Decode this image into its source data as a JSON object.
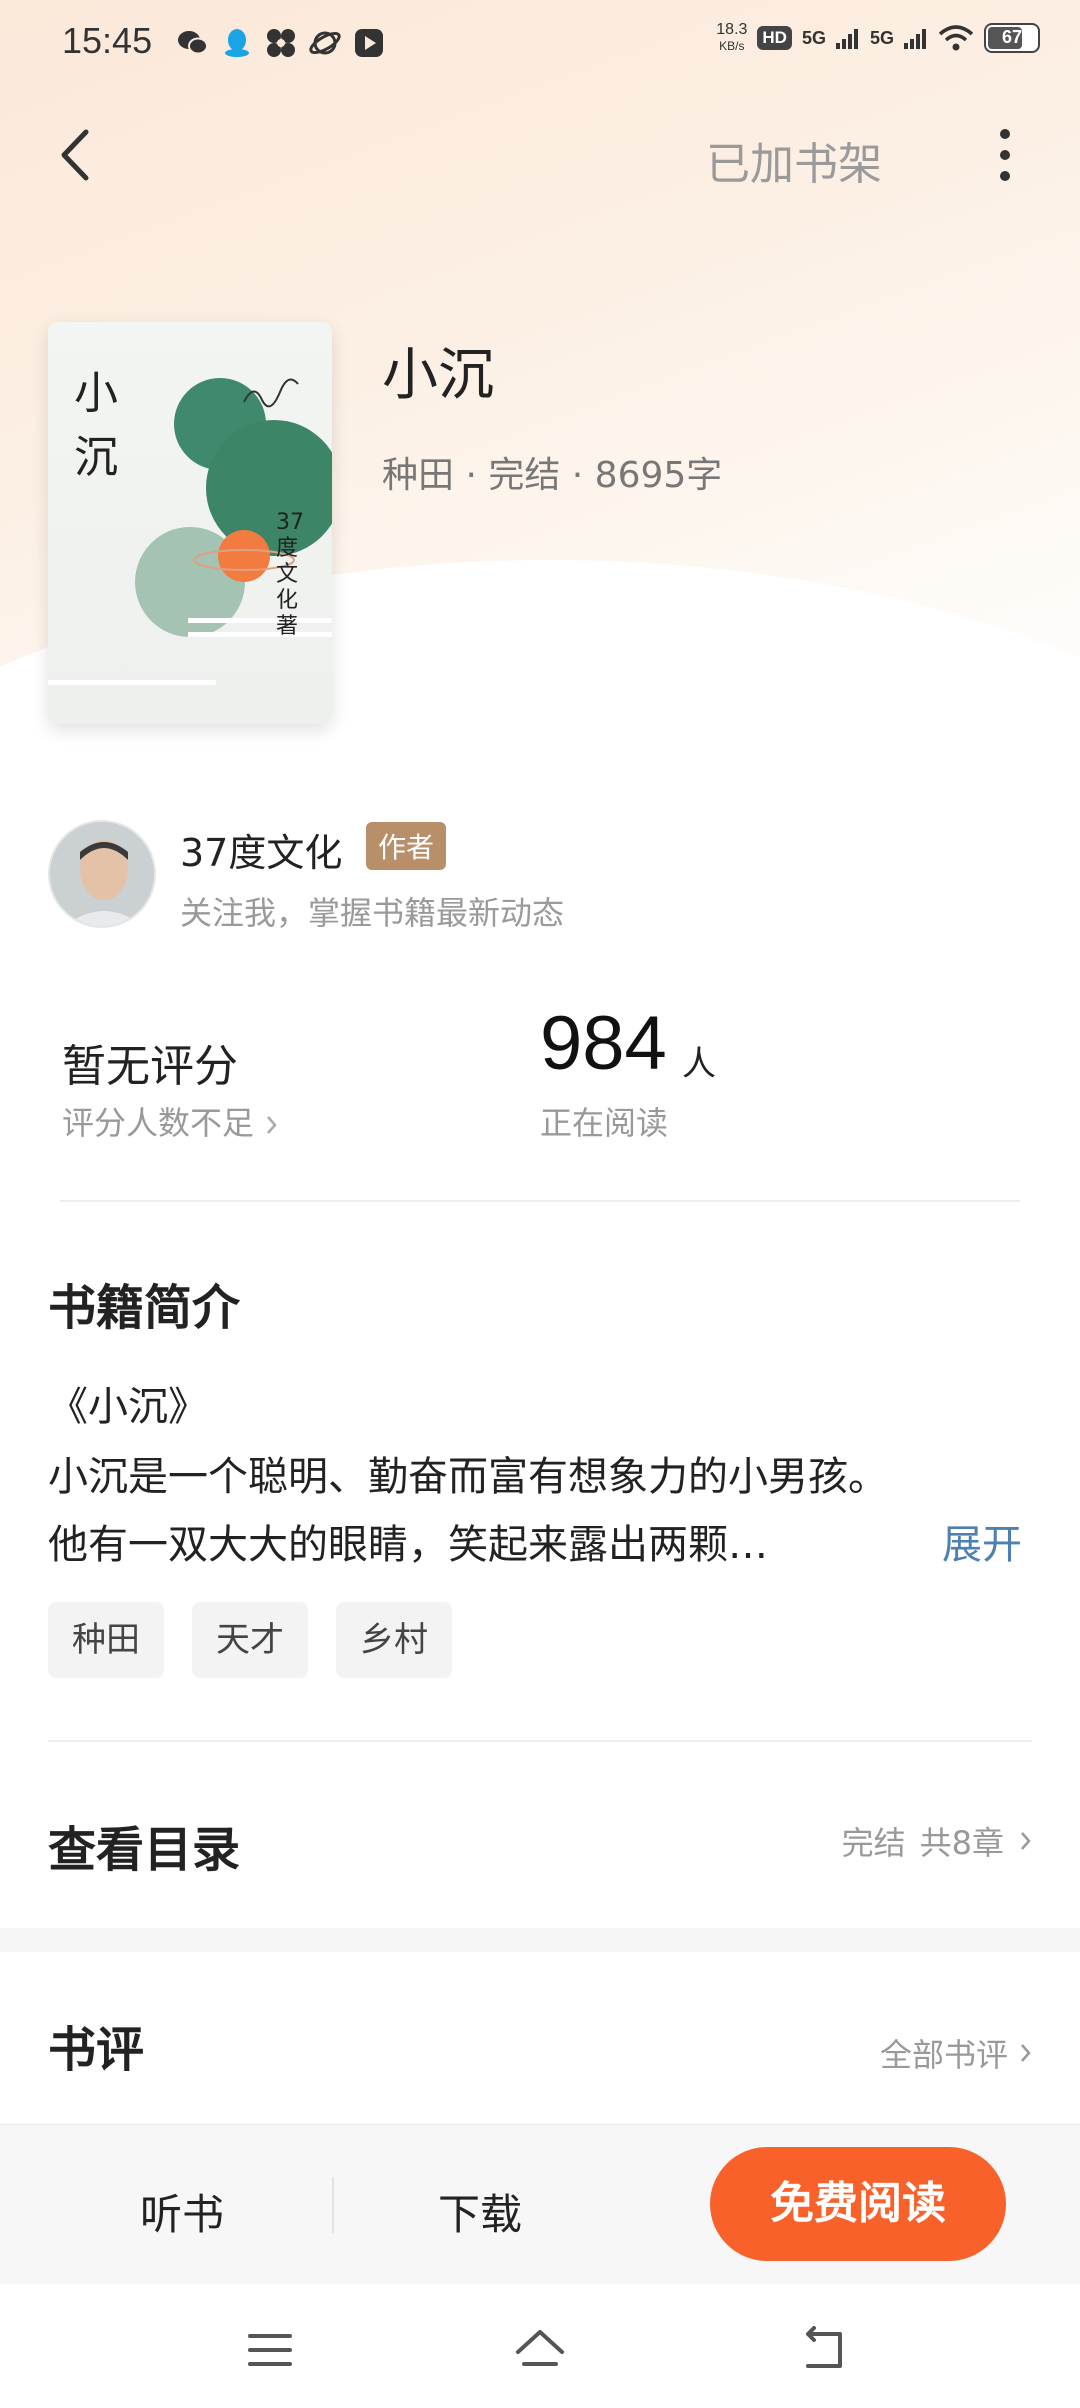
{
  "status_bar": {
    "time": "15:45",
    "net_speed_value": "18.3",
    "net_speed_unit": "KB/s",
    "hd_label": "HD",
    "signal1": "5G",
    "signal2": "5G",
    "battery": "67"
  },
  "nav": {
    "shelf_label": "已加书架"
  },
  "cover": {
    "title": "小沉",
    "author_vertical": "37度文化 著"
  },
  "book": {
    "title": "小沉",
    "meta": "种田 · 完结 · 8695字"
  },
  "author": {
    "name": "37度文化",
    "tag": "作者",
    "subtitle": "关注我，掌握书籍最新动态"
  },
  "stats": {
    "score_title": "暂无评分",
    "score_sub": "评分人数不足",
    "reading_count": "984",
    "reading_unit": "人",
    "reading_sub": "正在阅读"
  },
  "intro": {
    "section_title": "书籍简介",
    "line1": "《小沉》",
    "line2": "小沉是一个聪明、勤奋而富有想象力的小男孩。",
    "line3": "他有一双大大的眼睛，笑起来露出两颗…",
    "expand": "展开",
    "tags": [
      "种田",
      "天才",
      "乡村"
    ]
  },
  "toc": {
    "title": "查看目录",
    "status": "完结",
    "chapters": "共8章"
  },
  "reviews": {
    "title": "书评",
    "all_link": "全部书评"
  },
  "bottom_bar": {
    "listen": "听书",
    "download": "下载",
    "read_free": "免费阅读"
  },
  "colors": {
    "accent": "#f8622a",
    "link": "#4d7fb0",
    "author_tag": "#b98f6a"
  }
}
